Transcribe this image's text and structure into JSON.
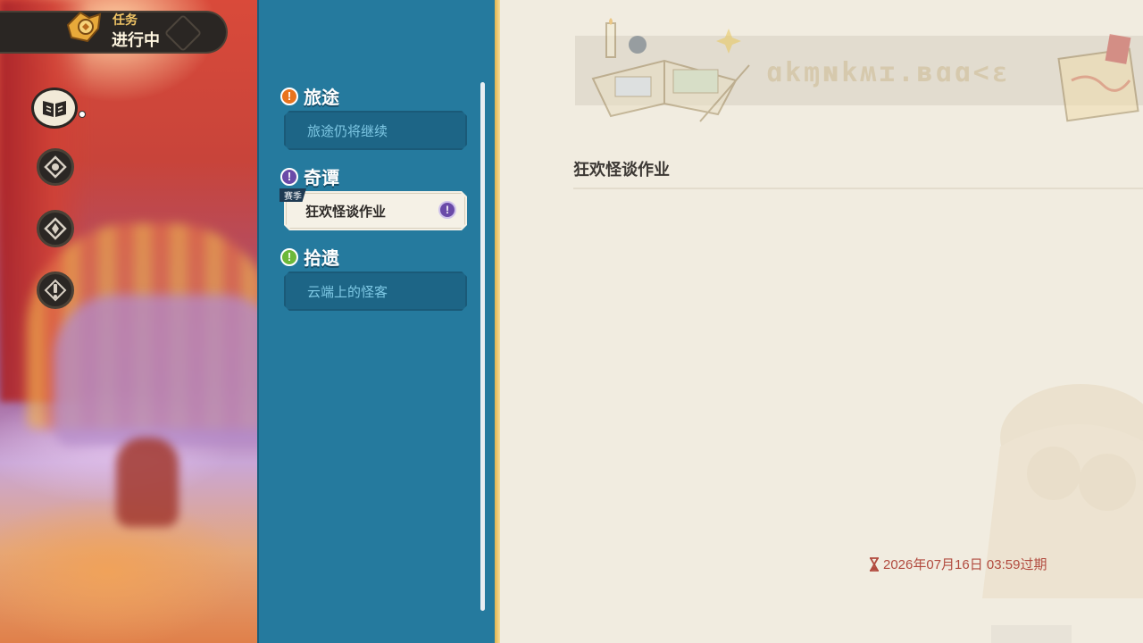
{
  "header": {
    "small_label": "任务",
    "big_label": "进行中"
  },
  "side_icons": [
    "book-icon",
    "compass-icon",
    "compass-icon",
    "exclamation-icon"
  ],
  "categories": [
    {
      "label": "旅途",
      "icon": "!",
      "color": "#e8731e",
      "quests": [
        {
          "label": "旅途仍将继续"
        }
      ]
    },
    {
      "label": "奇谭",
      "icon": "!",
      "color": "#6a4aa8",
      "quests": [
        {
          "label": "狂欢怪谈作业",
          "tag": "赛季",
          "mark": "!"
        }
      ]
    },
    {
      "label": "拾遗",
      "icon": "!",
      "color": "#6cb83a",
      "quests": [
        {
          "label": "云端上的怪客"
        }
      ]
    }
  ],
  "banner": {
    "runes": "ɑkɱɴkʍɪ.ʙɑɑ<ɛ"
  },
  "detail": {
    "title": "狂欢怪谈作业",
    "expiry": "2026年07月16日 03:59过期"
  },
  "colors": {
    "panel_blue": "#257a9e",
    "detail_bg": "#f1ece0",
    "expiry_red": "#b14a3e"
  }
}
